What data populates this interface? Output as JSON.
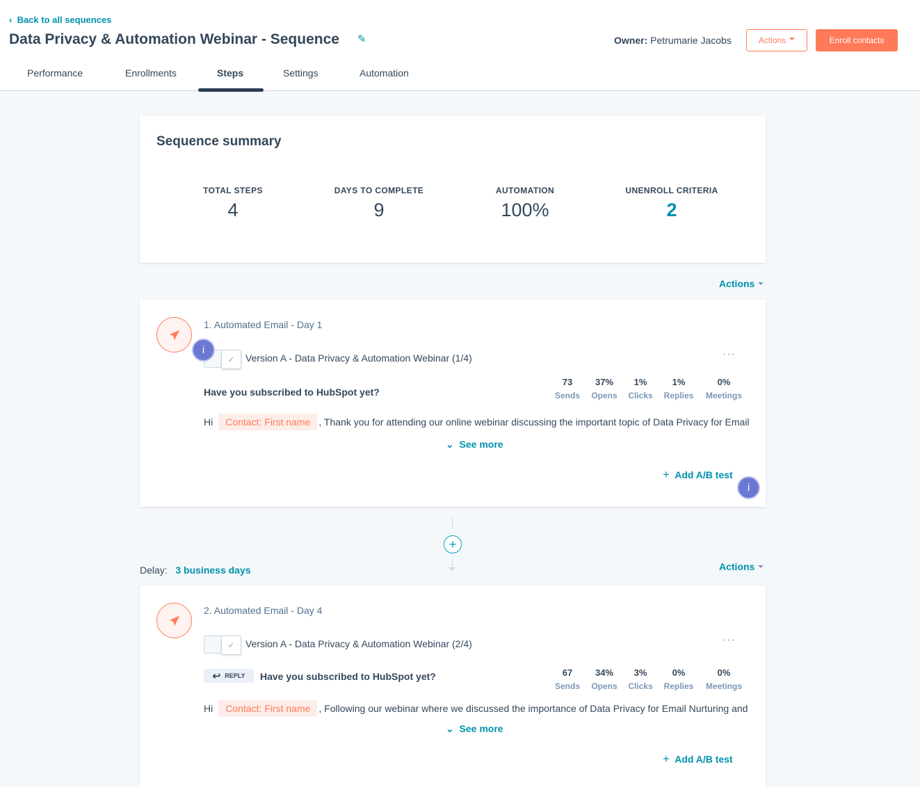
{
  "header": {
    "back_link": "Back to all sequences",
    "title": "Data Privacy & Automation Webinar - Sequence",
    "owner_label": "Owner:",
    "owner_name": "Petrumarie Jacobs",
    "actions_label": "Actions",
    "enroll_label": "Enroll contacts"
  },
  "tabs": [
    {
      "label": "Performance"
    },
    {
      "label": "Enrollments"
    },
    {
      "label": "Steps",
      "active": true
    },
    {
      "label": "Settings"
    },
    {
      "label": "Automation"
    }
  ],
  "summary": {
    "title": "Sequence summary",
    "stats": [
      {
        "label": "TOTAL STEPS",
        "value": "4"
      },
      {
        "label": "DAYS TO COMPLETE",
        "value": "9"
      },
      {
        "label": "AUTOMATION",
        "value": "100%"
      },
      {
        "label": "UNENROLL CRITERIA",
        "value": "2"
      }
    ]
  },
  "actions_label": "Actions",
  "metric_labels": [
    "Sends",
    "Opens",
    "Clicks",
    "Replies",
    "Meetings"
  ],
  "steps": [
    {
      "title": "1. Automated Email - Day 1",
      "version": "Version A - Data Privacy & Automation Webinar (1/4)",
      "subject": "Have you subscribed to HubSpot yet?",
      "metrics": [
        "73",
        "37%",
        "1%",
        "1%",
        "0%"
      ],
      "greeting": "Hi",
      "token": "Contact: First name",
      "body": ", Thank you for attending our online webinar discussing the important topic of Data Privacy for Email",
      "see_more": "See more",
      "add_ab": "Add A/B test"
    },
    {
      "title": "2. Automated Email - Day 4",
      "version": "Version A - Data Privacy & Automation Webinar (2/4)",
      "reply_badge": "REPLY",
      "subject": "Have you subscribed to HubSpot yet?",
      "metrics": [
        "67",
        "34%",
        "3%",
        "0%",
        "0%"
      ],
      "greeting": "Hi",
      "token": "Contact: First name",
      "body": ", Following our webinar where we discussed the importance of Data Privacy for Email Nurturing and",
      "see_more": "See more",
      "add_ab": "Add A/B test"
    }
  ],
  "delay": {
    "label": "Delay:",
    "value": "3 business days"
  },
  "info_badge": "i",
  "colors": {
    "accent": "#0091ae",
    "brand": "#ff7a59",
    "text": "#33475b",
    "info": "#6a78d1"
  }
}
